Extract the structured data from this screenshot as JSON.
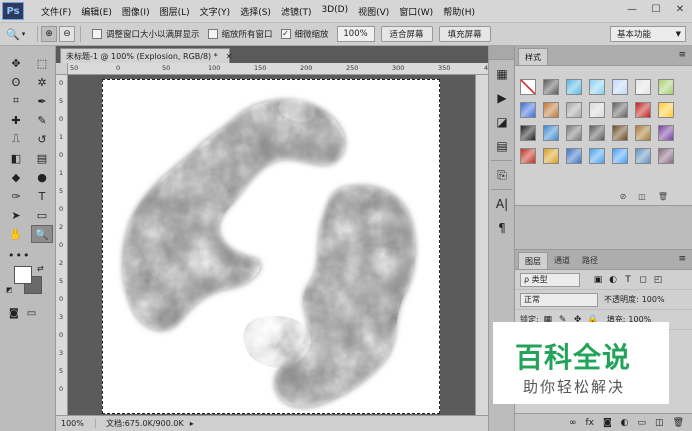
{
  "app": {
    "logo": "Ps"
  },
  "menu": [
    "文件(F)",
    "编辑(E)",
    "图像(I)",
    "图层(L)",
    "文字(Y)",
    "选择(S)",
    "滤镜(T)",
    "3D(D)",
    "视图(V)",
    "窗口(W)",
    "帮助(H)"
  ],
  "window_controls": {
    "minimize_icon": "minimize-icon",
    "maximize_icon": "maximize-icon",
    "close_icon": "close-icon"
  },
  "options": {
    "tool_icon": "zoom-icon",
    "zoom_in_icon": "zoom-in-icon",
    "zoom_out_icon": "zoom-out-icon",
    "resize_windows_label": "调整窗口大小以满屏显示",
    "resize_windows_checked": false,
    "zoom_all_windows_label": "缩放所有窗口",
    "zoom_all_windows_checked": false,
    "scrubby_zoom_label": "细微缩放",
    "scrubby_zoom_checked": true,
    "zoom_value": "100%",
    "fit_screen_label": "适合屏幕",
    "fill_screen_label": "填充屏幕",
    "workspace": "基本功能"
  },
  "document": {
    "tab_title": "未标题-1 @ 100% (Explosion, RGB/8) *",
    "ruler_h_ticks": [
      "50",
      "0",
      "50",
      "100",
      "150",
      "200",
      "250",
      "300",
      "350",
      "400"
    ],
    "ruler_v_ticks": [
      "0",
      "5",
      "0",
      "1",
      "0",
      "1",
      "5",
      "0",
      "2",
      "0",
      "2",
      "5",
      "0",
      "3",
      "0",
      "3",
      "5",
      "0"
    ],
    "status_zoom": "100%",
    "status_doc": "文档:675.0K/900.0K"
  },
  "tools": [
    "move-tool-icon",
    "marquee-tool-icon",
    "lasso-tool-icon",
    "magic-wand-tool-icon",
    "crop-tool-icon",
    "eyedropper-tool-icon",
    "healing-brush-tool-icon",
    "brush-tool-icon",
    "clone-stamp-tool-icon",
    "history-brush-tool-icon",
    "eraser-tool-icon",
    "gradient-tool-icon",
    "blur-tool-icon",
    "dodge-tool-icon",
    "pen-tool-icon",
    "type-tool-icon",
    "path-selection-tool-icon",
    "rectangle-tool-icon",
    "hand-tool-icon",
    "zoom-tool-icon"
  ],
  "tool_glyphs": [
    "✥",
    "⬚",
    "ʘ",
    "✲",
    "⌗",
    "✒",
    "✚",
    "✎",
    "⎍",
    "↺",
    "◧",
    "▤",
    "◆",
    "●",
    "✑",
    "T",
    "➤",
    "▭",
    "✋",
    "🔍"
  ],
  "styles_panel": {
    "tab": "样式",
    "swatch_colors": [
      "#ffffff",
      "#5a5a5a",
      "#5bb8e8",
      "#8ad0f0",
      "#c0d8f8",
      "#e4e4e4",
      "#a8d070",
      "#3c6cd8",
      "#c07838",
      "#a8a8a8",
      "#d8d8d8",
      "#606060",
      "#c02020",
      "#ffcc30",
      "#202020",
      "#3a88d0",
      "#7a7a7a",
      "#5a5a5a",
      "#6a4a20",
      "#a87a30",
      "#7840a0",
      "#c03020",
      "#d8a020",
      "#3a70c8",
      "#4aa0f0",
      "#48a0f8",
      "#6090c0",
      "#886880"
    ]
  },
  "layers_panel": {
    "tabs": [
      "图层",
      "通道",
      "路径"
    ],
    "filter_label": "ρ 类型",
    "blend_mode": "正常",
    "opacity_label": "不透明度:",
    "opacity_value": "100%",
    "lock_label": "锁定:",
    "fill_label": "填充:",
    "fill_value": "100%"
  },
  "watermark": {
    "title": "百科全说",
    "subtitle": "助你轻松解决"
  }
}
